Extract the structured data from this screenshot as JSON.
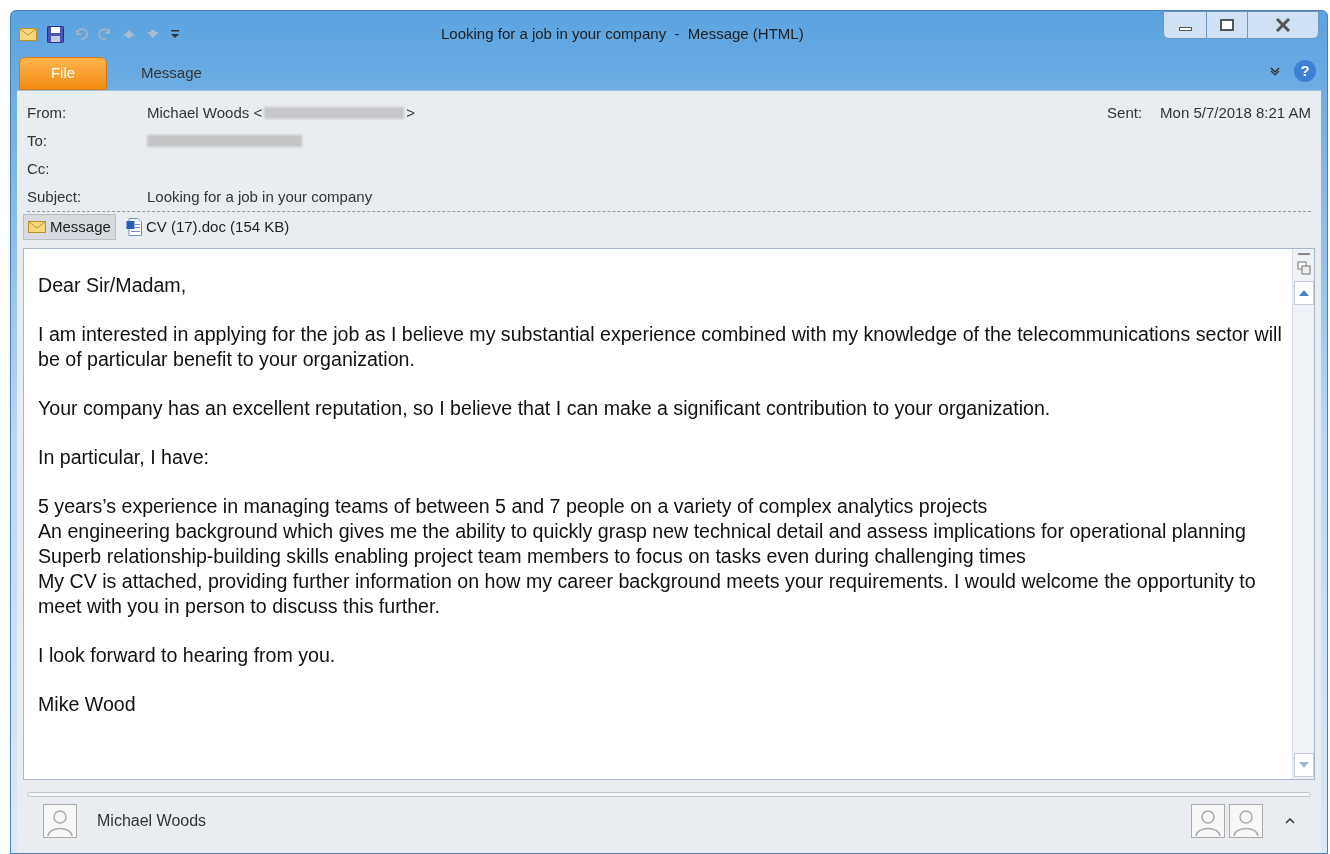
{
  "window": {
    "title": "Looking for a job in your company  -  Message (HTML)"
  },
  "ribbon_tabs": [
    {
      "label": "File",
      "kind": "file",
      "selected": false
    },
    {
      "label": "Message",
      "kind": "tab",
      "selected": false
    }
  ],
  "header": {
    "from": {
      "label": "From:",
      "name": "Michael Woods <",
      "tail": ">"
    },
    "to": {
      "label": "To:"
    },
    "cc": {
      "label": "Cc:"
    },
    "subject": {
      "label": "Subject:",
      "value": "Looking for a job in your company"
    },
    "sent": {
      "label": "Sent:",
      "value": "Mon 5/7/2018 8:21 AM"
    }
  },
  "attachments": [
    {
      "label": "Message",
      "kind": "message",
      "selected": true
    },
    {
      "label": "CV (17).doc (154 KB)",
      "kind": "doc",
      "selected": false
    }
  ],
  "body": [
    [
      "Dear Sir/Madam,"
    ],
    [
      "I am interested in applying for the job as I believe my substantial experience combined with my knowledge of the telecommunications sector will be of particular benefit to your organization."
    ],
    [
      "Your company has an excellent reputation, so I believe that I can make a significant contribution to your organization."
    ],
    [
      "In particular, I have:"
    ],
    [
      "5 years’s experience in managing teams of between 5 and 7 people on a variety of complex analytics projects",
      "An engineering background which gives me the ability to quickly grasp new technical detail and assess implications for operational planning",
      "Superb relationship-building skills enabling project team members to focus on tasks even during challenging times",
      "My CV is attached, providing further information on how my career background meets your requirements. I would welcome the opportunity to meet with you in person to discuss this further."
    ],
    [
      "I look forward to hearing from you."
    ],
    [
      "Mike Wood"
    ]
  ],
  "help": {
    "glyph": "?"
  },
  "people_pane": {
    "name": "Michael Woods"
  }
}
